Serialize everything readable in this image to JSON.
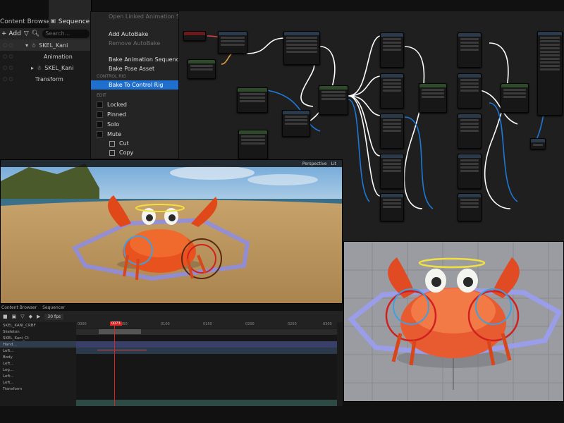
{
  "tabs": {
    "content_browser": "Content Browser",
    "sequencer": "Sequencer"
  },
  "toolbar": {
    "add_label": "Add",
    "search_placeholder": "Search..."
  },
  "tracks": [
    {
      "name": "SKEL_Kani",
      "selected": true
    },
    {
      "name": "Animation",
      "selected": false
    },
    {
      "name": "SKEL_Kani",
      "selected": false
    },
    {
      "name": "Transform",
      "selected": false
    }
  ],
  "context_menu": {
    "items_top": [
      {
        "label": "Open Linked Animation Seque",
        "dim": true
      },
      {
        "label": "Add AutoBake",
        "dim": false
      },
      {
        "label": "Remove AutoBake",
        "dim": true
      },
      {
        "label": "Bake Animation Sequence",
        "dim": false
      },
      {
        "label": "Bake Pose Asset",
        "dim": false
      }
    ],
    "section_control_rig": "CONTROL RIG",
    "highlight_item": "Bake To Control Rig",
    "section_edit": "EDIT",
    "checkboxes": [
      "Locked",
      "Pinned",
      "Solo",
      "Mute"
    ],
    "sub_items": [
      "Cut",
      "Copy"
    ]
  },
  "viewport1": {
    "mode": "Perspective",
    "lit": "Lit",
    "colors": {
      "sky": "#8fb8de",
      "sand": "#c9a36b",
      "crab": "#e8521f"
    }
  },
  "bottom_sequencer": {
    "tabs": [
      "Content Browser",
      "Sequencer"
    ],
    "fps": "30 fps",
    "rows": [
      "SKEL_KANI_CRBF",
      "Skeleton",
      "SKEL_Kani_Ct",
      "Hand...",
      "Left...",
      "Body",
      "Left...",
      "Leg...",
      "Left...",
      "Left...",
      "Transform"
    ],
    "playhead_frame": "0073",
    "ruler_ticks": [
      "0000",
      "0050",
      "0100",
      "0150",
      "0200",
      "0250",
      "0300"
    ]
  }
}
